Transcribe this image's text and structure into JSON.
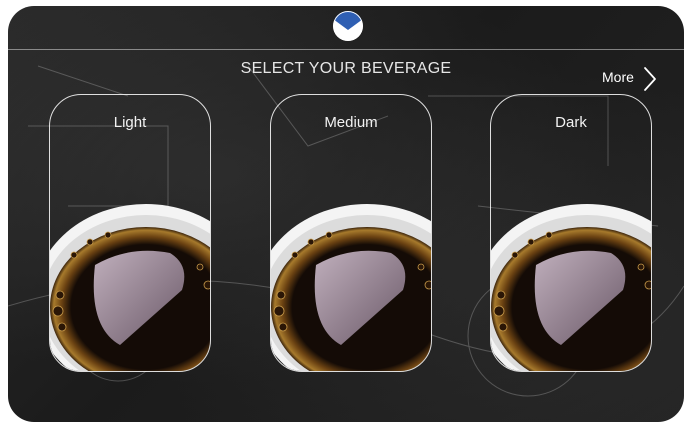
{
  "header": {
    "logo_icon": "brand-logo-icon",
    "title": "SELECT YOUR BEVERAGE"
  },
  "more": {
    "label": "More",
    "icon": "chevron-right-icon"
  },
  "beverages": [
    {
      "label": "Light"
    },
    {
      "label": "Medium"
    },
    {
      "label": "Dark"
    }
  ],
  "colors": {
    "accent": "#2f5fb3",
    "background": "#1f1f1f",
    "card_border": "#ffffff"
  }
}
